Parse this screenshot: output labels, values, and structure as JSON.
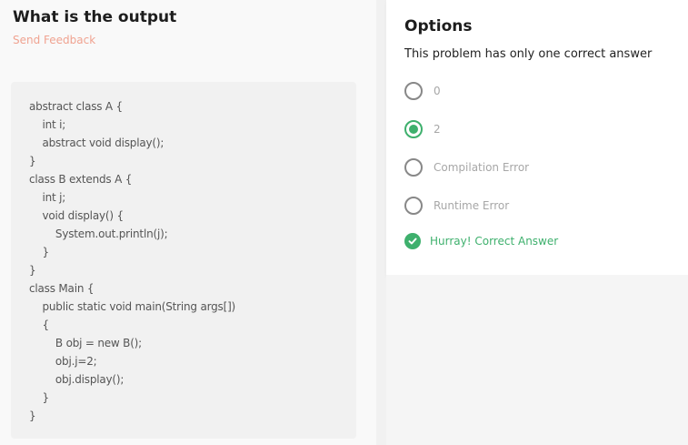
{
  "question": {
    "title": "What is the output",
    "feedback_link": "Send Feedback",
    "code_lines": [
      "abstract class A {",
      "    int i;",
      "    abstract void display();",
      "}",
      "class B extends A {",
      "    int j;",
      "    void display() {",
      "        System.out.println(j);",
      "    }",
      "}",
      "class Main {",
      "    public static void main(String args[])",
      "    {",
      "        B obj = new B();",
      "        obj.j=2;",
      "        obj.display();",
      "    }",
      "}"
    ]
  },
  "options_panel": {
    "heading": "Options",
    "subtitle": "This problem has only one correct answer",
    "options": [
      {
        "label": "0",
        "selected": false
      },
      {
        "label": "2",
        "selected": true
      },
      {
        "label": "Compilation Error",
        "selected": false
      },
      {
        "label": "Runtime Error",
        "selected": false
      }
    ],
    "result": "Hurray! Correct Answer"
  },
  "colors": {
    "accent_green": "#3eb06d",
    "feedback_link": "#f0a391"
  },
  "icons": {
    "result": "check-circle-icon"
  }
}
